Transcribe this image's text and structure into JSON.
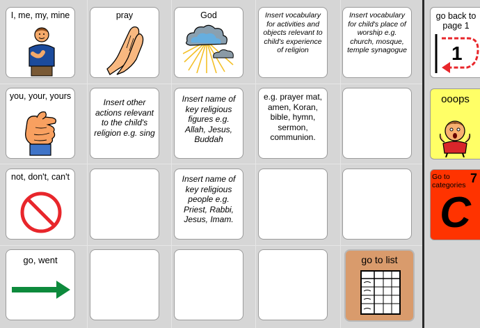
{
  "cells": {
    "me": "I, me, my, mine",
    "pray": "pray",
    "god": "God",
    "vocab_activities": "Insert vocabulary for activities and objects relevant to child's experience of religion",
    "vocab_worship": "Insert vocabulary for child's place of worship e.g. church, mosque, temple synagogue",
    "you": "you, your, yours",
    "other_actions": "Insert other actions relevant to the child's religion e.g. sing",
    "key_figures": "Insert name of key religious figures e.g. Allah, Jesus, Buddah",
    "examples": "e.g. prayer mat, amen, Koran, bible, hymn, sermon, communion.",
    "not": "not, don't, can't",
    "key_people": "Insert name of key religious people e.g. Priest, Rabbi, Jesus, Imam.",
    "go": "go, went",
    "go_list": "go to list"
  },
  "side": {
    "back": "go back to page 1",
    "back_number": "1",
    "ooops": "ooops",
    "categories": "Go to categories",
    "categories_number": "7",
    "categories_letter": "C"
  },
  "colors": {
    "ooops_bg": "#ffff66",
    "categories_bg": "#ff3300",
    "go_list_bg": "#d99b6c",
    "arrow": "#0d8a3c",
    "no_sign": "#e8262b"
  },
  "icons": {
    "me": "person-pointing-self-icon",
    "pray": "praying-hands-icon",
    "god": "cloud-sunrays-icon",
    "you": "pointing-finger-icon",
    "not": "prohibited-icon",
    "go": "green-arrow-icon",
    "go_list": "list-table-icon",
    "back": "return-arrow-icon",
    "ooops": "surprised-face-icon"
  }
}
